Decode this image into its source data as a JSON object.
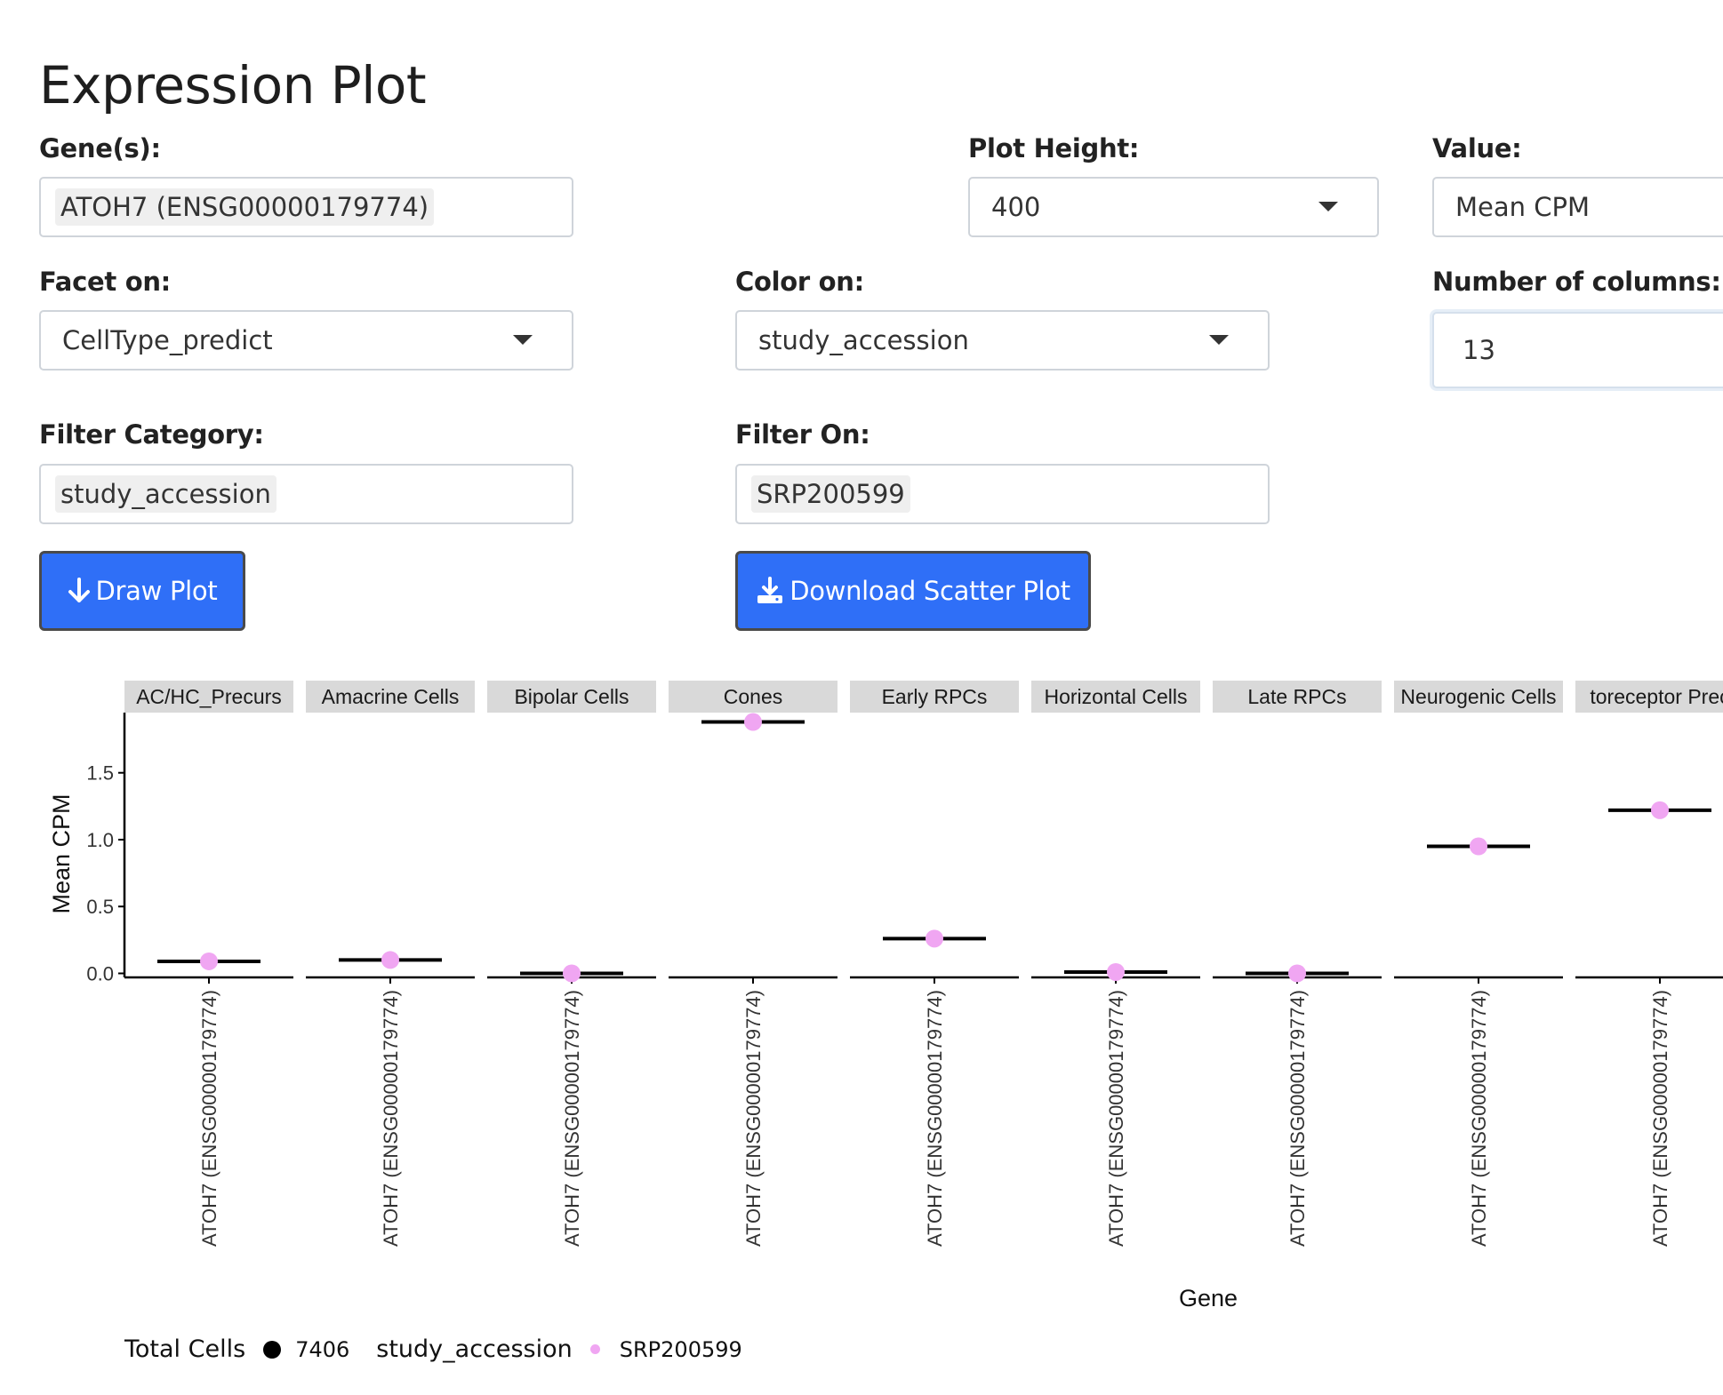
{
  "page": {
    "title": "Expression Plot"
  },
  "form": {
    "genes": {
      "label": "Gene(s):",
      "value": "ATOH7 (ENSG00000179774)"
    },
    "plot_height": {
      "label": "Plot Height:",
      "value": "400"
    },
    "value": {
      "label": "Value:",
      "value": "Mean CPM"
    },
    "facet_on": {
      "label": "Facet on:",
      "value": "CellType_predict"
    },
    "color_on": {
      "label": "Color on:",
      "value": "study_accession"
    },
    "num_columns": {
      "label": "Number of columns:",
      "value": "13"
    },
    "filter_category": {
      "label": "Filter Category:",
      "value": "study_accession"
    },
    "filter_on": {
      "label": "Filter On:",
      "value": "SRP200599"
    }
  },
  "buttons": {
    "draw_plot": "Draw Plot",
    "download_scatter": "Download Scatter Plot"
  },
  "colors": {
    "accent": "#2f6ff7",
    "point": "#f0a6f2",
    "strip": "#d9d9d9"
  },
  "chart_data": {
    "type": "scatter",
    "xlabel": "Gene",
    "ylabel": "Mean CPM",
    "ylim": [
      -0.03,
      1.95
    ],
    "yticks": [
      0.0,
      0.5,
      1.0,
      1.5
    ],
    "ytick_labels": [
      "0.0",
      "0.5",
      "1.0",
      "1.5"
    ],
    "x_tick_label": "ATOH7 (ENSG00000179774)",
    "facets": [
      {
        "label": "AC/HC_Precurs",
        "value": 0.09
      },
      {
        "label": "Amacrine Cells",
        "value": 0.1
      },
      {
        "label": "Bipolar Cells",
        "value": 0.0
      },
      {
        "label": "Cones",
        "value": 1.88
      },
      {
        "label": "Early RPCs",
        "value": 0.26
      },
      {
        "label": "Horizontal Cells",
        "value": 0.01
      },
      {
        "label": "Late RPCs",
        "value": 0.0
      },
      {
        "label": "Neurogenic Cells",
        "value": 0.95
      },
      {
        "label": "toreceptor Prec",
        "value": 1.22
      }
    ],
    "legend": {
      "size_title": "Total Cells",
      "size_value": "7406",
      "color_title": "study_accession",
      "color_value": "SRP200599"
    }
  }
}
